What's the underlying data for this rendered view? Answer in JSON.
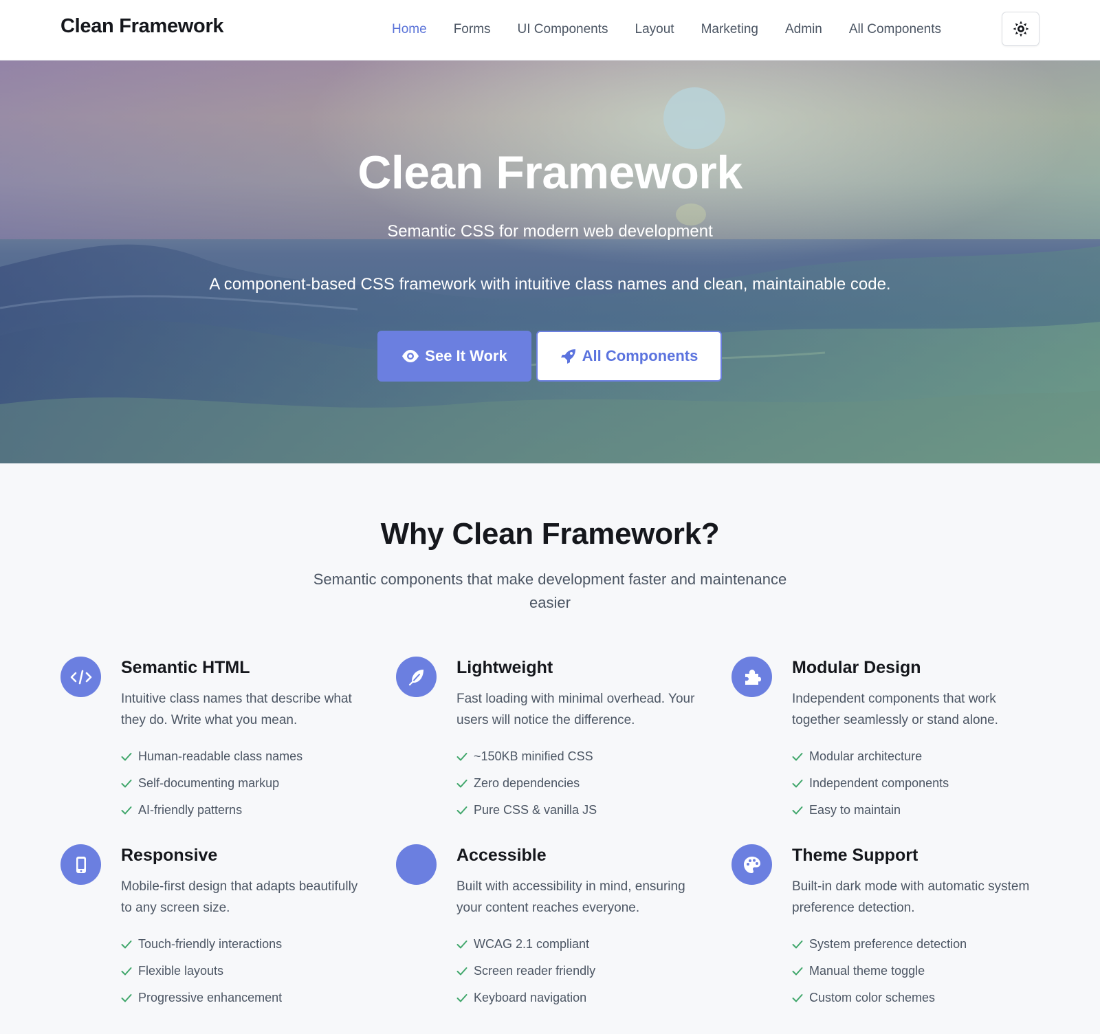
{
  "nav": {
    "brand": "Clean Framework",
    "links": [
      {
        "label": "Home",
        "active": true
      },
      {
        "label": "Forms"
      },
      {
        "label": "UI Components"
      },
      {
        "label": "Layout"
      },
      {
        "label": "Marketing"
      },
      {
        "label": "Admin"
      },
      {
        "label": "All Components"
      }
    ],
    "theme_toggle_icon": "sun-icon"
  },
  "hero": {
    "title": "Clean Framework",
    "subtitle": "Semantic CSS for modern web development",
    "description": "A component-based CSS framework with intuitive class names and clean, maintainable code.",
    "primary_button": {
      "label": "See It Work",
      "icon": "eye-icon"
    },
    "secondary_button": {
      "label": "All Components",
      "icon": "rocket-icon"
    }
  },
  "features": {
    "title": "Why Clean Framework?",
    "lead": "Semantic components that make development faster and maintenance easier",
    "items": [
      {
        "icon": "code-icon",
        "title": "Semantic HTML",
        "description": "Intuitive class names that describe what they do. Write what you mean.",
        "points": [
          "Human-readable class names",
          "Self-documenting markup",
          "AI-friendly patterns"
        ]
      },
      {
        "icon": "feather-icon",
        "title": "Lightweight",
        "description": "Fast loading with minimal overhead. Your users will notice the difference.",
        "points": [
          "~150KB minified CSS",
          "Zero dependencies",
          "Pure CSS & vanilla JS"
        ]
      },
      {
        "icon": "puzzle-icon",
        "title": "Modular Design",
        "description": "Independent components that work together seamlessly or stand alone.",
        "points": [
          "Modular architecture",
          "Independent components",
          "Easy to maintain"
        ]
      },
      {
        "icon": "mobile-icon",
        "title": "Responsive",
        "description": "Mobile-first design that adapts beautifully to any screen size.",
        "points": [
          "Touch-friendly interactions",
          "Flexible layouts",
          "Progressive enhancement"
        ]
      },
      {
        "icon": "accessibility-icon",
        "title": "Accessible",
        "description": "Built with accessibility in mind, ensuring your content reaches everyone.",
        "points": [
          "WCAG 2.1 compliant",
          "Screen reader friendly",
          "Keyboard navigation"
        ]
      },
      {
        "icon": "palette-icon",
        "title": "Theme Support",
        "description": "Built-in dark mode with automatic system preference detection.",
        "points": [
          "System preference detection",
          "Manual theme toggle",
          "Custom color schemes"
        ]
      }
    ]
  },
  "colors": {
    "accent": "#6b7fe0",
    "nav_active": "#5a73d8",
    "check": "#3fa66a"
  }
}
